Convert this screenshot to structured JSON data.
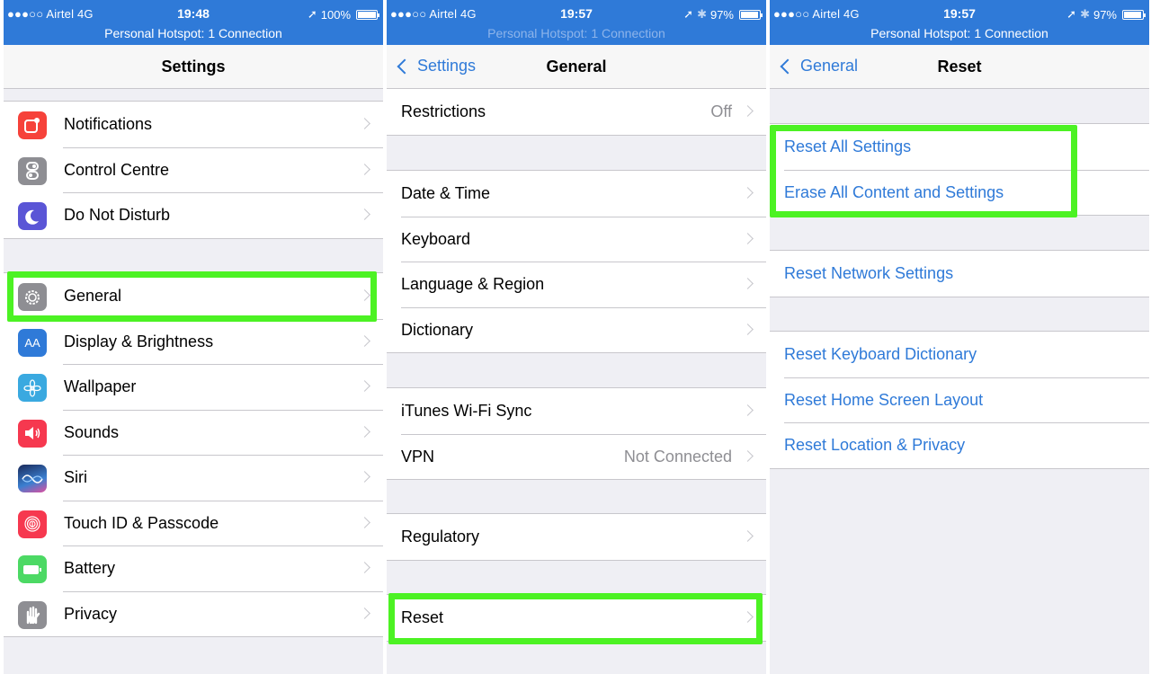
{
  "panels": [
    {
      "status": {
        "carrier": "●●●○○ Airtel  4G",
        "time": "19:48",
        "battery": "100%",
        "battery_level": 1.0,
        "hotspot": "Personal Hotspot: 1 Connection"
      },
      "nav": {
        "title": "Settings",
        "back": ""
      },
      "groups": [
        {
          "items": [
            {
              "label": "Notifications",
              "icon": "notifications-icon",
              "color": "#f6423a"
            },
            {
              "label": "Control Centre",
              "icon": "control-centre-icon",
              "color": "#8e8e93"
            },
            {
              "label": "Do Not Disturb",
              "icon": "moon-icon",
              "color": "#5a55d6"
            }
          ]
        },
        {
          "items": [
            {
              "label": "General",
              "icon": "gear-icon",
              "color": "#8e8e93",
              "highlighted": true
            },
            {
              "label": "Display & Brightness",
              "icon": "display-brightness-icon",
              "glyph": "AA",
              "color": "#2f7ad8"
            },
            {
              "label": "Wallpaper",
              "icon": "wallpaper-flower-icon",
              "color": "#3aa9e0"
            },
            {
              "label": "Sounds",
              "icon": "speaker-icon",
              "color": "#f6384f"
            },
            {
              "label": "Siri",
              "icon": "siri-icon",
              "color": "#1a2a5a"
            },
            {
              "label": "Touch ID & Passcode",
              "icon": "fingerprint-icon",
              "color": "#f6384f"
            },
            {
              "label": "Battery",
              "icon": "battery-icon",
              "color": "#4cd964"
            },
            {
              "label": "Privacy",
              "icon": "hand-icon",
              "color": "#8e8e93"
            }
          ]
        }
      ]
    },
    {
      "status": {
        "carrier": "●●●○○ Airtel  4G",
        "time": "19:57",
        "battery": "97%",
        "battery_level": 0.97,
        "hotspot": "Personal Hotspot: 1 Connection"
      },
      "nav": {
        "title": "General",
        "back": "Settings"
      },
      "groups": [
        {
          "items": [
            {
              "label": "Restrictions",
              "value": "Off"
            }
          ]
        },
        {
          "items": [
            {
              "label": "Date & Time"
            },
            {
              "label": "Keyboard"
            },
            {
              "label": "Language & Region"
            },
            {
              "label": "Dictionary"
            }
          ]
        },
        {
          "items": [
            {
              "label": "iTunes Wi-Fi Sync"
            },
            {
              "label": "VPN",
              "value": "Not Connected"
            }
          ]
        },
        {
          "items": [
            {
              "label": "Regulatory"
            }
          ]
        },
        {
          "items": [
            {
              "label": "Reset",
              "highlighted": true
            }
          ]
        }
      ]
    },
    {
      "status": {
        "carrier": "●●●○○ Airtel  4G",
        "time": "19:57",
        "battery": "97%",
        "battery_level": 0.97,
        "hotspot": "Personal Hotspot: 1 Connection"
      },
      "nav": {
        "title": "Reset",
        "back": "General"
      },
      "groups": [
        {
          "items": [
            {
              "label": "Reset All Settings"
            },
            {
              "label": "Erase All Content and Settings"
            }
          ]
        },
        {
          "items": [
            {
              "label": "Reset Network Settings"
            }
          ]
        },
        {
          "items": [
            {
              "label": "Reset Keyboard Dictionary"
            },
            {
              "label": "Reset Home Screen Layout"
            },
            {
              "label": "Reset Location & Privacy"
            }
          ]
        }
      ]
    }
  ],
  "colors": {
    "accent": "#2f7ad8",
    "highlight": "#4cf223",
    "separator": "#c8c7cc",
    "background": "#efeff4"
  }
}
